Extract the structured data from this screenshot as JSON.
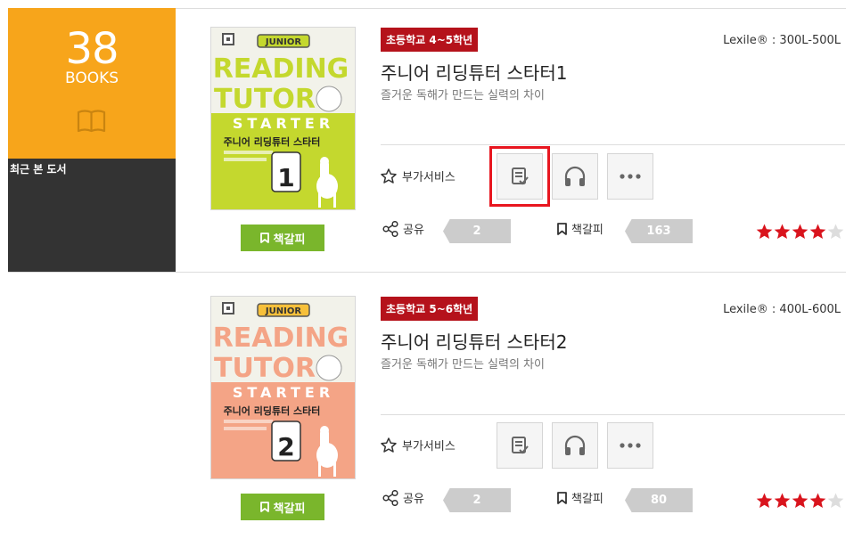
{
  "sidebar": {
    "count": "38",
    "count_unit": "BOOKS",
    "icon": "open-book-icon",
    "recent_label": "최근 본 도서",
    "colors": {
      "accent": "#f7a51b",
      "dark": "#333333"
    }
  },
  "books": [
    {
      "cover": {
        "badge": "JUNIOR",
        "line1": "READING",
        "line2": "TUTOR",
        "starter": "STARTER",
        "korean": "주니어 리딩튜터 스타터",
        "level": "1",
        "top_color": "#c4d82e",
        "bottom_color": "#c4d82e"
      },
      "bookmark_button": "책갈피",
      "grade": "초등학교 4~5학년",
      "lexile": "Lexile® : 300L-500L",
      "title": "주니어 리딩튜터 스타터1",
      "subtitle": "즐거운 독해가 만드는 실력의 차이",
      "extra_service_label": "부가서비스",
      "share_label": "공유",
      "share_count": "2",
      "bookmark_label": "책갈피",
      "bookmark_count": "163",
      "rating": 4
    },
    {
      "cover": {
        "badge": "JUNIOR",
        "line1": "READING",
        "line2": "TUTOR",
        "starter": "STARTER",
        "korean": "주니어 리딩튜터 스타터",
        "level": "2",
        "top_color": "#f4a486",
        "bottom_color": "#f4a486"
      },
      "bookmark_button": "책갈피",
      "grade": "초등학교 5~6학년",
      "lexile": "Lexile® : 400L-600L",
      "title": "주니어 리딩튜터 스타터2",
      "subtitle": "즐거운 독해가 만드는 실력의 차이",
      "extra_service_label": "부가서비스",
      "share_label": "공유",
      "share_count": "2",
      "bookmark_label": "책갈피",
      "bookmark_count": "80",
      "rating": 4
    }
  ],
  "colors": {
    "grade_badge": "#b5121b",
    "bookmark_button": "#7ab62c",
    "star": "#d9141d",
    "highlight": "#e8161f"
  }
}
